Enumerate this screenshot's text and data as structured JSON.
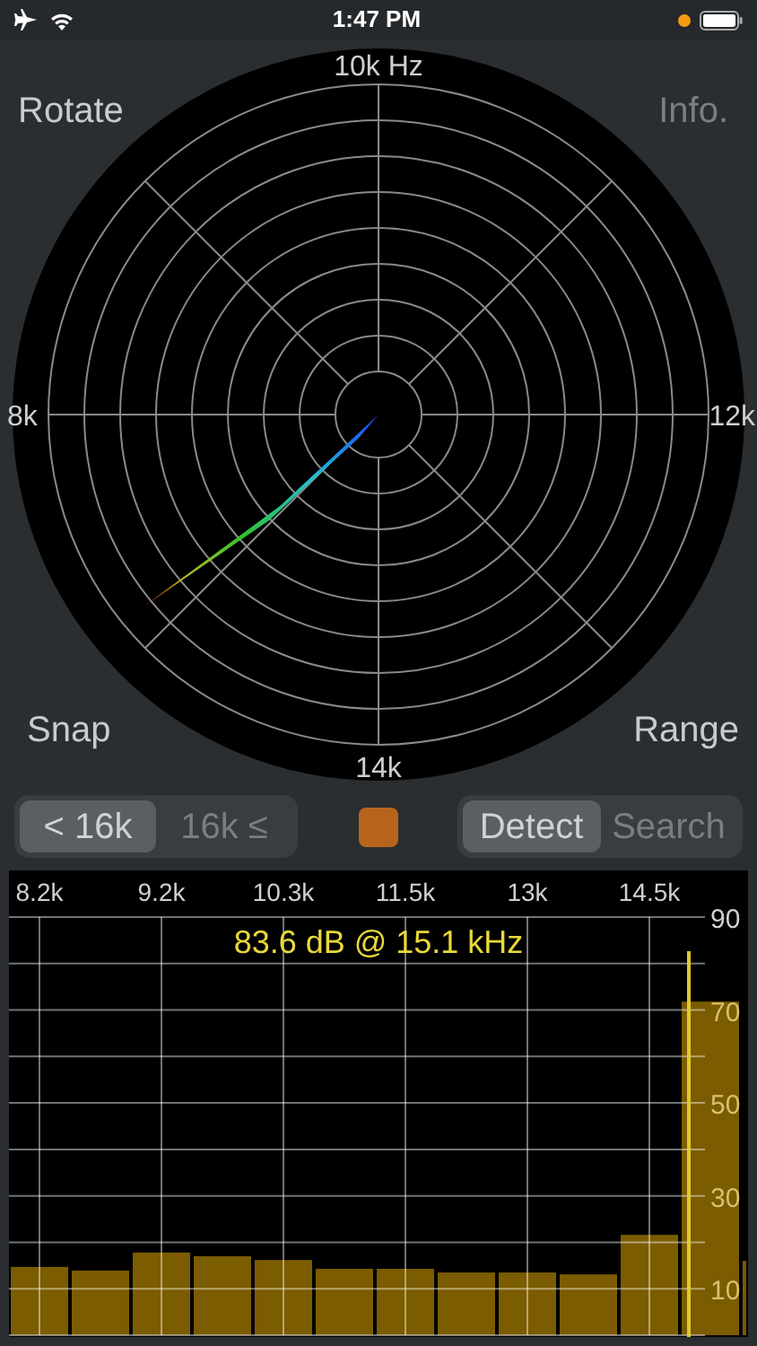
{
  "status_bar": {
    "time": "1:47 PM"
  },
  "polar": {
    "axis_labels": [
      "10k Hz",
      "8k",
      "12k",
      "14k"
    ],
    "corner_buttons": [
      {
        "label": "Rotate",
        "disabled": false
      },
      {
        "label": "Info.",
        "disabled": true
      },
      {
        "label": "Snap",
        "disabled": false
      },
      {
        "label": "Range",
        "disabled": false
      }
    ]
  },
  "range_toggle": [
    {
      "label": "< 16k",
      "selected": true
    },
    {
      "label": "16k ≤",
      "selected": false
    }
  ],
  "mode_toggle": [
    {
      "label": "Detect",
      "selected": true
    },
    {
      "label": "Search",
      "selected": false
    }
  ],
  "spectrum": {
    "readout": "83.6 dB @ 15.1 kHz",
    "chart_data": {
      "type": "bar",
      "categories": [
        "8.2k",
        null,
        "9.2k",
        null,
        "10.3k",
        null,
        "11.5k",
        null,
        "13k",
        null,
        "14.5k",
        null,
        null
      ],
      "values": [
        14.7,
        13.9,
        17.8,
        17,
        16.2,
        14.3,
        14.3,
        13.5,
        13.5,
        13.1,
        21.6,
        71.8,
        16
      ],
      "ylim": [
        0,
        90
      ],
      "yticks": [
        10,
        30,
        50,
        70,
        90
      ],
      "grid": true
    }
  }
}
